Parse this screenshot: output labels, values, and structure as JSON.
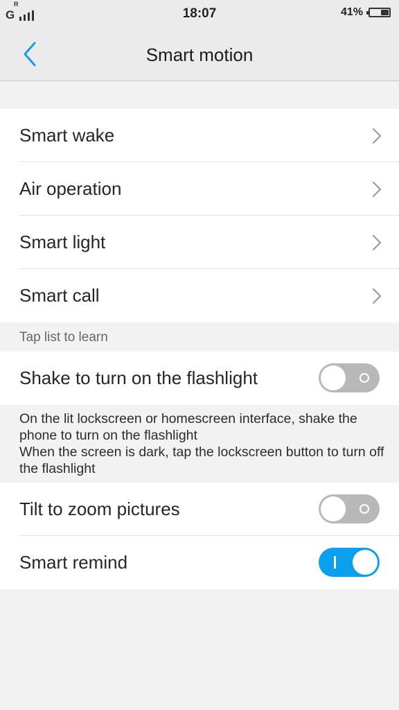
{
  "status_bar": {
    "network": "G",
    "roaming": "R",
    "time": "18:07",
    "battery_percent": "41%",
    "battery_level": 0.41
  },
  "header": {
    "title": "Smart motion",
    "back_icon": "chevron-left-icon",
    "accent_color": "#1a9be8"
  },
  "menu_items": [
    {
      "label": "Smart wake",
      "icon": "chevron-right-icon"
    },
    {
      "label": "Air operation",
      "icon": "chevron-right-icon"
    },
    {
      "label": "Smart light",
      "icon": "chevron-right-icon"
    },
    {
      "label": "Smart call",
      "icon": "chevron-right-icon"
    }
  ],
  "hint": "Tap list to learn",
  "flashlight": {
    "label": "Shake to turn on the flashlight",
    "enabled": false,
    "description": "On the lit lockscreen or homescreen interface, shake the phone to turn on the flashlight\n When the screen is dark, tap the lockscreen button to turn off the flashlight"
  },
  "tilt_zoom": {
    "label": "Tilt to zoom pictures",
    "enabled": false
  },
  "smart_remind": {
    "label": "Smart remind",
    "enabled": true
  },
  "colors": {
    "toggle_on": "#0aa0ee",
    "toggle_off": "#b8b8b8"
  }
}
